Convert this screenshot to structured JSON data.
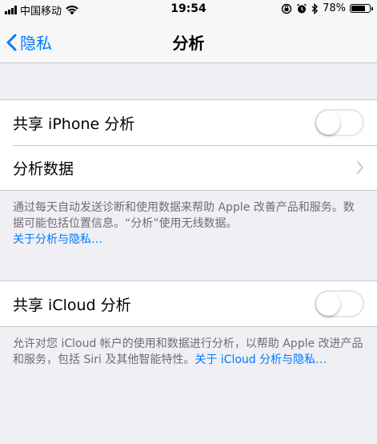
{
  "status": {
    "carrier": "中国移动",
    "time": "19:54",
    "battery": "78%",
    "battery_level": 0.78
  },
  "nav": {
    "back_label": "隐私",
    "title": "分析"
  },
  "group1": {
    "share_iphone_label": "共享 iPhone 分析",
    "share_iphone_on": false,
    "analytics_data_label": "分析数据"
  },
  "footnote1": {
    "text": "通过每天自动发送诊断和使用数据来帮助 Apple 改善产品和服务。数据可能包括位置信息。“分析”使用无线数据。",
    "link": "关于分析与隐私…"
  },
  "group2": {
    "share_icloud_label": "共享 iCloud 分析",
    "share_icloud_on": false
  },
  "footnote2": {
    "text": "允许对您 iCloud 帐户的使用和数据进行分析，以帮助 Apple 改进产品和服务，包括 Siri 及其他智能特性。",
    "link": "关于 iCloud 分析与隐私…"
  },
  "colors": {
    "accent": "#007aff",
    "background": "#efeff4",
    "footnote": "#6d6d72"
  }
}
